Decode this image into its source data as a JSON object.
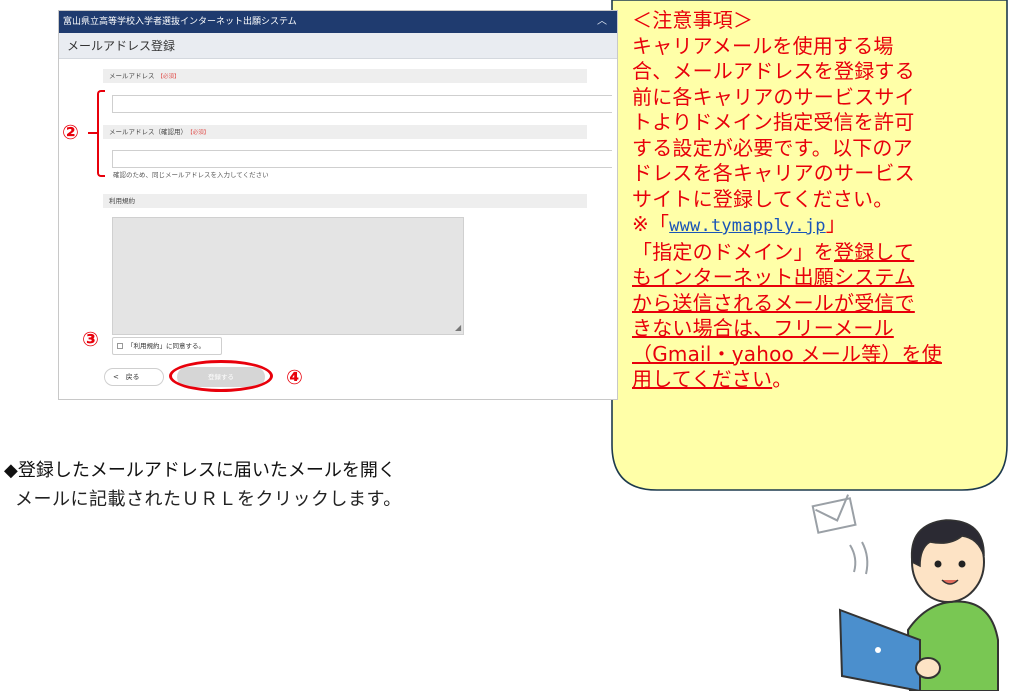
{
  "system": {
    "title": "富山県立高等学校入学者選抜インターネット出願システム",
    "menu_icon": "chevron-icon"
  },
  "page": {
    "heading": "メールアドレス登録"
  },
  "form": {
    "email_label": "メールアドレス",
    "email_confirm_label": "メールアドレス（確認用）",
    "required_badge": "【必須】",
    "email_value": "",
    "email_confirm_value": "",
    "confirm_hint": "確認のため、同じメールアドレスを入力してください",
    "terms_label": "利用規約",
    "terms_text": "",
    "agree_label": "「利用規約」に同意する。",
    "back_label": "戻る",
    "back_glyph": "<",
    "register_label": "登録する"
  },
  "annotations": {
    "marker2": "②",
    "marker3": "③",
    "marker4": "④",
    "accent_color": "#e8000b"
  },
  "notice": {
    "heading": "＜注意事項＞",
    "lines": [
      "キャリアメールを使用する場",
      "合、メールアドレスを登録する",
      "前に各キャリアのサービスサイ",
      "トよりドメイン指定受信を許可",
      "する設定が必要です。以下のア",
      "ドレスを各キャリアのサービス",
      "サイトに登録してください。"
    ],
    "domain_prefix": "※「",
    "domain": "www.tymapply.jp",
    "domain_suffix": "」",
    "warn_prefix": "「指定のドメイン」を",
    "warn_lines": [
      "登録して",
      "もインターネット出願システム",
      "から送信されるメールが受信で",
      "きない場合は、フリーメール",
      "（Gmail・yahoo メール等）を使",
      "用してください"
    ],
    "warn_end": "。"
  },
  "step": {
    "heading": "◆登録したメールアドレスに届いたメールを開く",
    "body": "メールに記載されたＵＲＬをクリックします。"
  },
  "illustration": {
    "icon": "person-with-laptop-mail-icon"
  }
}
